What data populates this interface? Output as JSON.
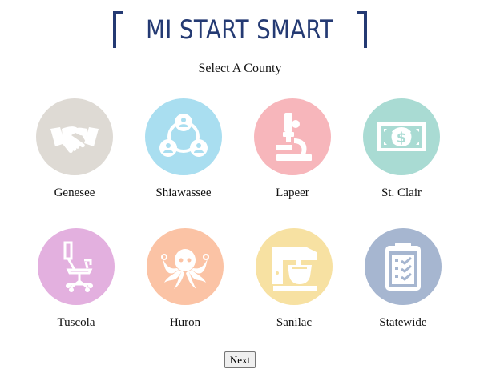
{
  "brand": {
    "name": "MI START SMART"
  },
  "page": {
    "subtitle": "Select A County"
  },
  "counties": [
    {
      "label": "Genesee",
      "color": "#dedad4",
      "icon": "handshake-icon"
    },
    {
      "label": "Shiawassee",
      "color": "#a9def0",
      "icon": "people-network-icon"
    },
    {
      "label": "Lapeer",
      "color": "#f7b6bb",
      "icon": "microscope-icon"
    },
    {
      "label": "St. Clair",
      "color": "#a9dbd3",
      "icon": "money-bill-icon"
    },
    {
      "label": "Tuscola",
      "color": "#e3b0df",
      "icon": "office-chair-icon"
    },
    {
      "label": "Huron",
      "color": "#fbc3a5",
      "icon": "octopus-icon"
    },
    {
      "label": "Sanilac",
      "color": "#f7e1a2",
      "icon": "stand-mixer-icon"
    },
    {
      "label": "Statewide",
      "color": "#a6b6d0",
      "icon": "clipboard-checklist-icon"
    }
  ],
  "actions": {
    "next_label": "Next"
  }
}
